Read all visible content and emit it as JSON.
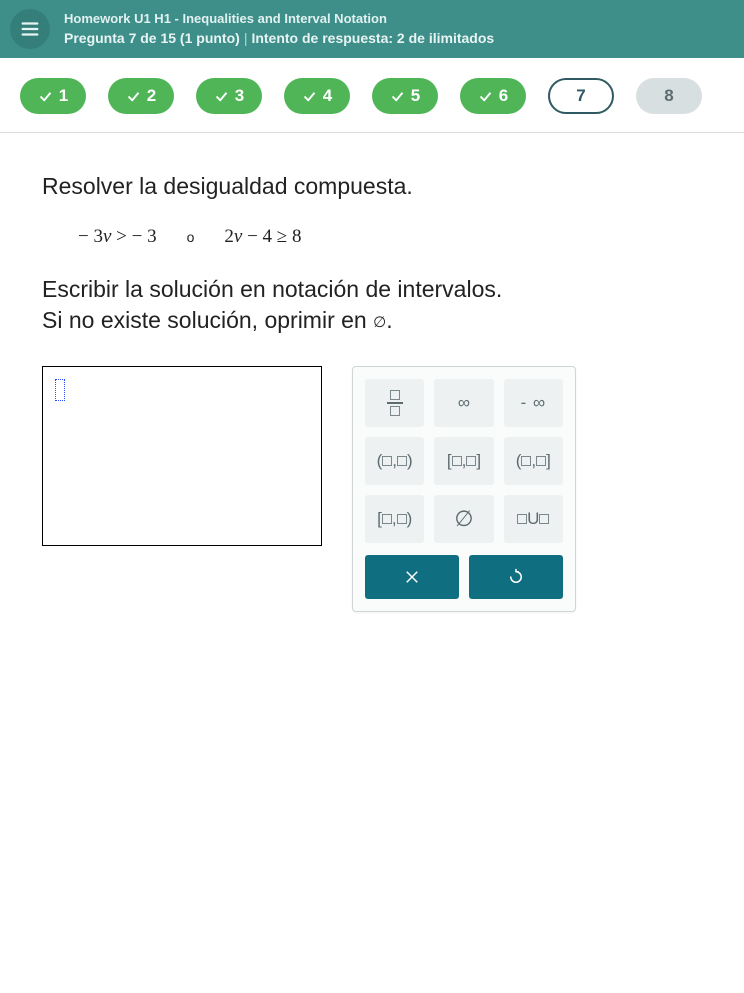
{
  "header": {
    "title": "Homework U1 H1 - Inequalities and Interval Notation",
    "question_label": "Pregunta 7 de 15 (1 punto)",
    "attempt_label": "Intento de respuesta: 2 de ilimitados"
  },
  "nav": {
    "pills": [
      {
        "n": "1",
        "state": "done"
      },
      {
        "n": "2",
        "state": "done"
      },
      {
        "n": "3",
        "state": "done"
      },
      {
        "n": "4",
        "state": "done"
      },
      {
        "n": "5",
        "state": "done"
      },
      {
        "n": "6",
        "state": "done"
      },
      {
        "n": "7",
        "state": "current"
      },
      {
        "n": "8",
        "state": "future"
      }
    ]
  },
  "prompt": {
    "line1": "Resolver la desigualdad compuesta.",
    "ineq1_a": "− 3",
    "ineq1_v": "v",
    "ineq1_b": " > − 3",
    "or": "o",
    "ineq2_a": "2",
    "ineq2_v": "v",
    "ineq2_b": " − 4 ≥ 8",
    "line2a": "Escribir la solución en notación de intervalos.",
    "line2b_pre": "Si no existe solución, oprimir en ",
    "line2b_sym": "∅",
    "line2b_post": "."
  },
  "palette": {
    "keys": {
      "fraction": "frac",
      "inf": "∞",
      "neg_inf": "-∞",
      "open_open": "(▫,▫)",
      "closed_closed": "[▫,▫]",
      "open_closed": "(▫,▫]",
      "closed_open": "[▫,▫)",
      "empty": "∅",
      "union": "▫U▫"
    },
    "actions": {
      "clear": "×",
      "undo": "↺"
    }
  }
}
